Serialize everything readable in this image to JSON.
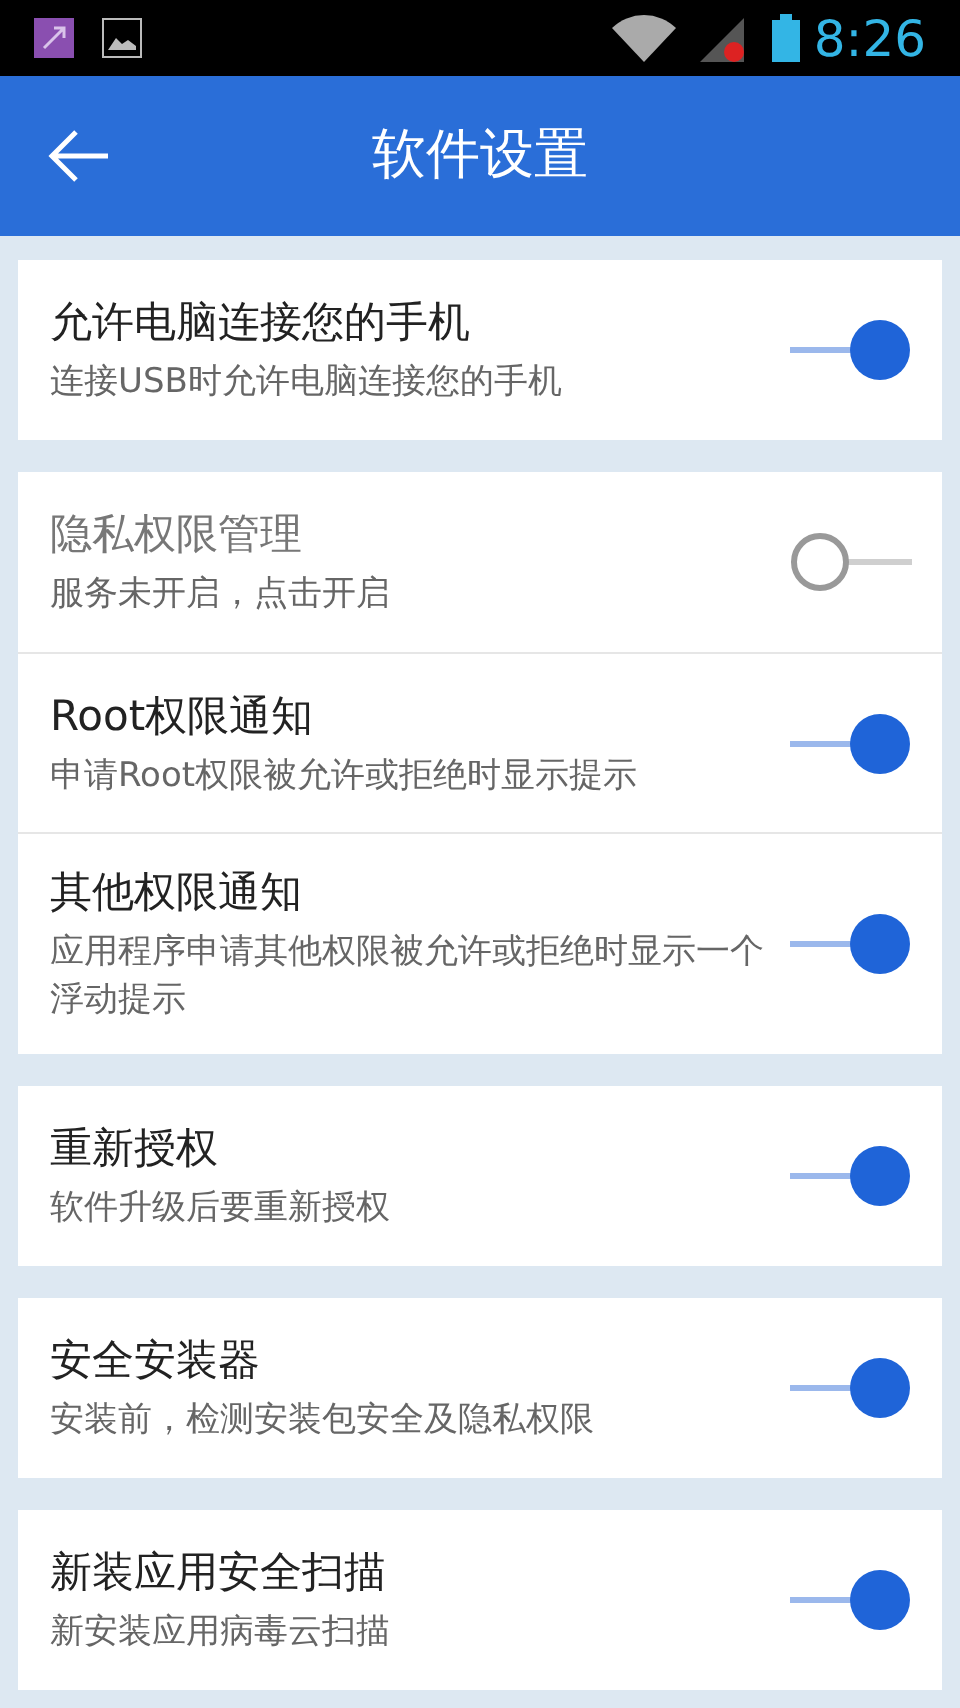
{
  "status_bar": {
    "time": "8:26"
  },
  "header": {
    "title": "软件设置"
  },
  "groups": [
    {
      "items": [
        {
          "title": "允许电脑连接您的手机",
          "subtitle": "连接USB时允许电脑连接您的手机",
          "on": true
        }
      ]
    },
    {
      "items": [
        {
          "title": "隐私权限管理",
          "subtitle": "服务未开启，点击开启",
          "on": false
        },
        {
          "title": "Root权限通知",
          "subtitle": "申请Root权限被允许或拒绝时显示提示",
          "on": true
        },
        {
          "title": "其他权限通知",
          "subtitle": "应用程序申请其他权限被允许或拒绝时显示一个浮动提示",
          "on": true
        }
      ]
    },
    {
      "items": [
        {
          "title": "重新授权",
          "subtitle": "软件升级后要重新授权",
          "on": true
        }
      ]
    },
    {
      "items": [
        {
          "title": "安全安装器",
          "subtitle": "安装前，检测安装包安全及隐私权限",
          "on": true
        }
      ]
    },
    {
      "items": [
        {
          "title": "新装应用安全扫描",
          "subtitle": "新安装应用病毒云扫描",
          "on": true
        }
      ]
    }
  ]
}
